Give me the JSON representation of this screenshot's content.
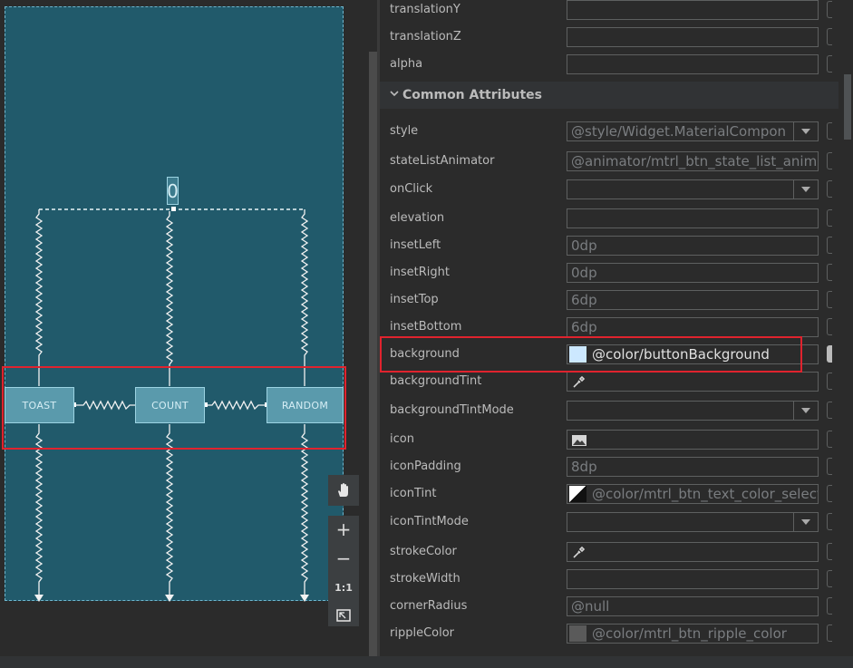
{
  "layout_preview": {
    "buttons": [
      {
        "label": "TOAST"
      },
      {
        "label": "COUNT"
      },
      {
        "label": "RANDOM"
      }
    ],
    "count_text": "0",
    "zoom_toolbar": {
      "pan_icon": "hand-icon",
      "zoom_in": "+",
      "zoom_out": "−",
      "actual_size": "1:1",
      "fit_icon": "fit-screen-icon"
    }
  },
  "attributes": {
    "top_rows": [
      {
        "name": "translationY",
        "value": ""
      },
      {
        "name": "translationZ",
        "value": ""
      },
      {
        "name": "alpha",
        "value": ""
      }
    ],
    "section_title": "Common Attributes",
    "rows": [
      {
        "name": "style",
        "value": "@style/Widget.MaterialCompon",
        "type": "dropdown"
      },
      {
        "name": "stateListAnimator",
        "value": "@animator/mtrl_btn_state_list_anim",
        "type": "text"
      },
      {
        "name": "onClick",
        "value": "",
        "type": "dropdown"
      },
      {
        "name": "elevation",
        "value": "",
        "type": "text"
      },
      {
        "name": "insetLeft",
        "value": "0dp",
        "type": "text"
      },
      {
        "name": "insetRight",
        "value": "0dp",
        "type": "text"
      },
      {
        "name": "insetTop",
        "value": "6dp",
        "type": "text"
      },
      {
        "name": "insetBottom",
        "value": "6dp",
        "type": "text"
      },
      {
        "name": "background",
        "value": "@color/buttonBackground",
        "type": "color",
        "swatch": "#cce8ff"
      },
      {
        "name": "backgroundTint",
        "value": "",
        "type": "eyedropper"
      },
      {
        "name": "backgroundTintMode",
        "value": "",
        "type": "dropdown"
      },
      {
        "name": "icon",
        "value": "",
        "type": "image"
      },
      {
        "name": "iconPadding",
        "value": "8dp",
        "type": "text"
      },
      {
        "name": "iconTint",
        "value": "@color/mtrl_btn_text_color_select",
        "type": "color-split"
      },
      {
        "name": "iconTintMode",
        "value": "",
        "type": "dropdown"
      },
      {
        "name": "strokeColor",
        "value": "",
        "type": "eyedropper"
      },
      {
        "name": "strokeWidth",
        "value": "",
        "type": "text"
      },
      {
        "name": "cornerRadius",
        "value": "@null",
        "type": "text"
      },
      {
        "name": "rippleColor",
        "value": "@color/mtrl_btn_ripple_color",
        "type": "color",
        "swatch": "#5a5a5a"
      }
    ]
  },
  "colors": {
    "blueprint": "#215a6b",
    "highlight": "#e0232e",
    "accent_text": "#d6eef5"
  }
}
